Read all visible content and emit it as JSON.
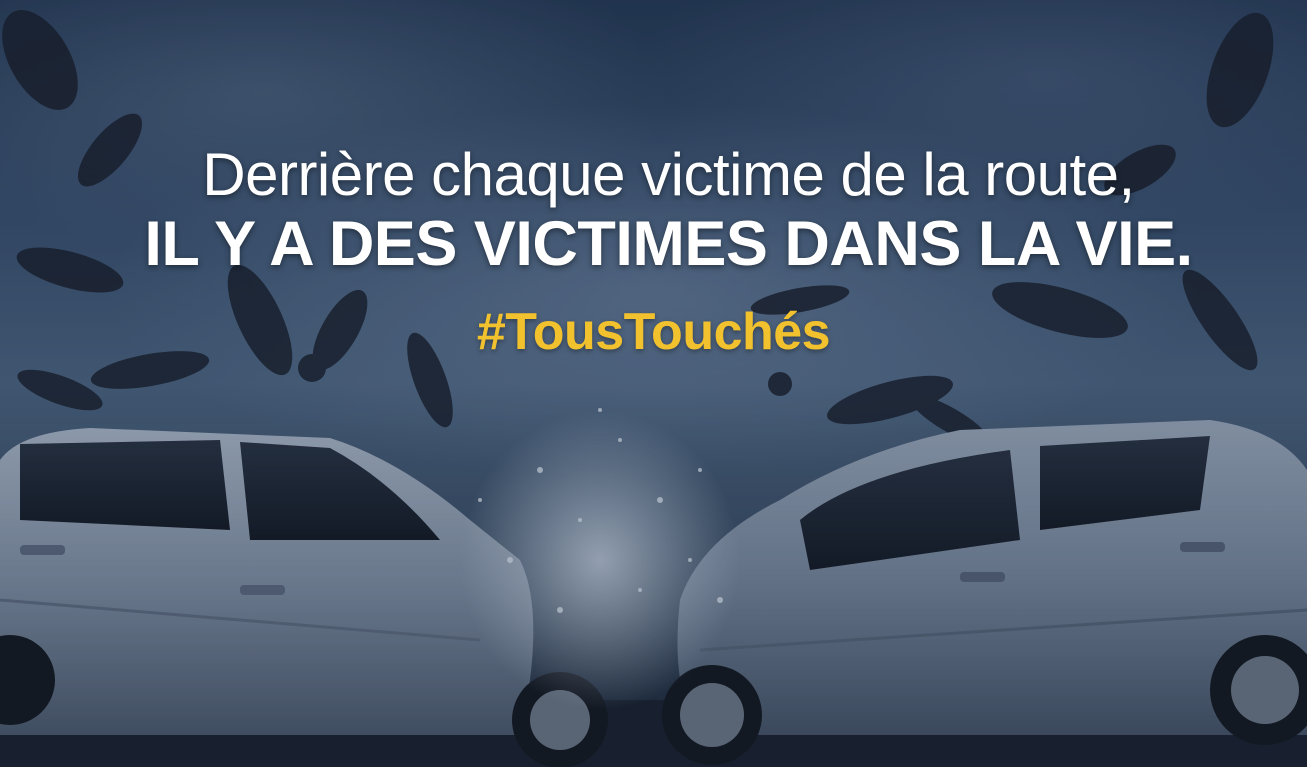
{
  "headline": {
    "line1": "Derrière chaque victime de la route,",
    "line2": "IL Y A DES VICTIMES DANS LA VIE."
  },
  "hashtag": {
    "text": "#TousTouchés",
    "color": "#f2c12e"
  },
  "scene": {
    "description_icon": "car-crash-scene"
  }
}
